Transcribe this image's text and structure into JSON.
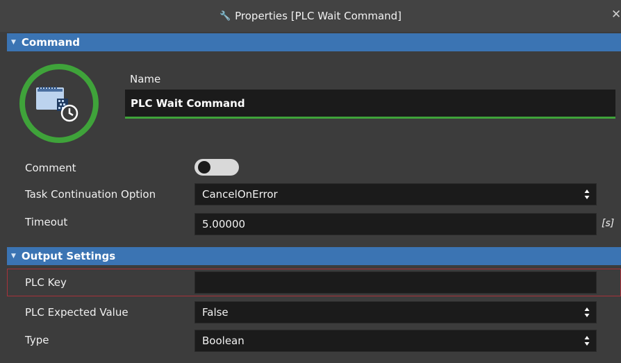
{
  "window": {
    "title": "Properties [PLC Wait Command]",
    "close_glyph": "✕"
  },
  "sections": {
    "command": "Command",
    "output": "Output Settings"
  },
  "command": {
    "icon": "plc-device-icon",
    "name_label": "Name",
    "name_value": "PLC Wait Command",
    "comment_label": "Comment",
    "comment_enabled": false,
    "task_option_label": "Task Continuation Option",
    "task_option_value": "CancelOnError",
    "timeout_label": "Timeout",
    "timeout_value": "5.00000",
    "timeout_unit": "[s]"
  },
  "output": {
    "plc_key_label": "PLC Key",
    "plc_key_value": "",
    "expected_label": "PLC Expected Value",
    "expected_value": "False",
    "type_label": "Type",
    "type_value": "Boolean"
  },
  "colors": {
    "section_header": "#3b74b3",
    "name_underline": "#3fa33a",
    "avatar_ring": "#3fa33a",
    "error_border": "#a8323a",
    "field_bg": "#1b1b1b"
  }
}
